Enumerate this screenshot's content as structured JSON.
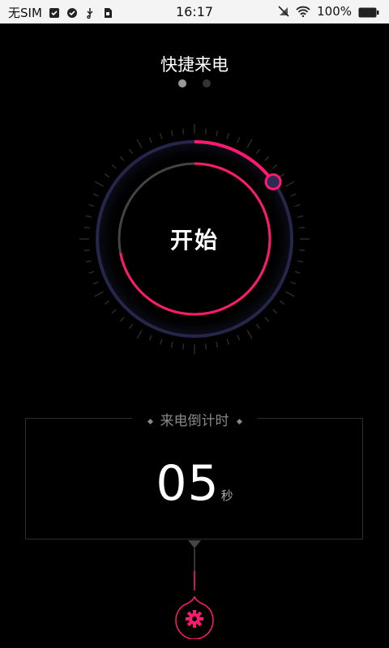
{
  "status_bar": {
    "carrier": "无SIM",
    "time": "16:17",
    "battery": "100%",
    "icons": [
      "clipboard-check-icon",
      "check-circle-icon",
      "usb-icon",
      "sd-card-icon",
      "mute-icon",
      "wifi-icon",
      "battery-icon"
    ]
  },
  "header": {
    "title": "快捷来电"
  },
  "pager": {
    "pages": 2,
    "active_index": 0
  },
  "dial": {
    "button_label": "开始",
    "progress": 0.72,
    "accent_color": "#ff1a6e",
    "track_color": "#2a2a44"
  },
  "countdown": {
    "title": "来电倒计时",
    "value": "05",
    "unit": "秒"
  },
  "settings": {
    "icon": "gear-icon",
    "color": "#ff1a6e"
  }
}
